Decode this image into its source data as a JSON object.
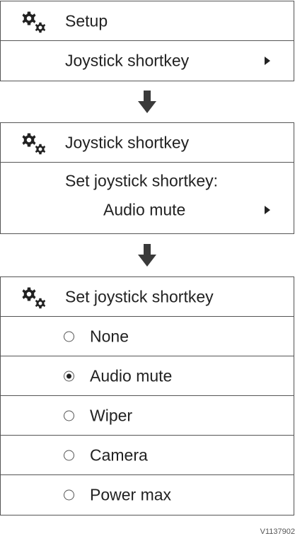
{
  "screen1": {
    "title": "Setup",
    "item": "Joystick shortkey"
  },
  "screen2": {
    "title": "Joystick shortkey",
    "prompt": "Set joystick shortkey:",
    "value": "Audio mute"
  },
  "screen3": {
    "title": "Set joystick shortkey",
    "options": [
      {
        "label": "None",
        "selected": false
      },
      {
        "label": "Audio mute",
        "selected": true
      },
      {
        "label": "Wiper",
        "selected": false
      },
      {
        "label": "Camera",
        "selected": false
      },
      {
        "label": "Power max",
        "selected": false
      }
    ]
  },
  "figure_code": "V1137902",
  "icons": {
    "header": "settings-gears-icon",
    "submenu": "triangle-right-icon",
    "flow": "arrow-down-icon"
  },
  "colors": {
    "text": "#222222",
    "border": "#555555"
  }
}
